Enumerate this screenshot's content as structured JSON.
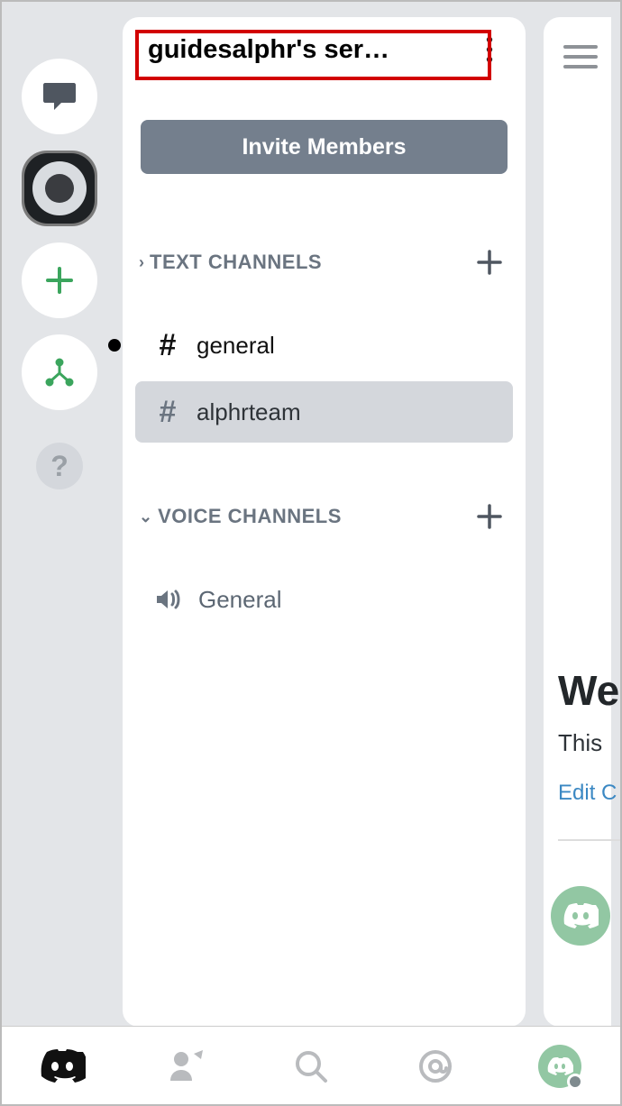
{
  "server": {
    "name": "guidesalphr's ser…",
    "invite_button": "Invite Members"
  },
  "sections": {
    "text": {
      "title": "TEXT CHANNELS"
    },
    "voice": {
      "title": "VOICE CHANNELS"
    }
  },
  "text_channels": [
    {
      "name": "general",
      "unread": true,
      "selected": false
    },
    {
      "name": "alphrteam",
      "unread": false,
      "selected": true
    }
  ],
  "voice_channels": [
    {
      "name": "General"
    }
  ],
  "right_peek": {
    "welcome_fragment": "We",
    "this_fragment": "This",
    "edit_fragment": "Edit C"
  }
}
